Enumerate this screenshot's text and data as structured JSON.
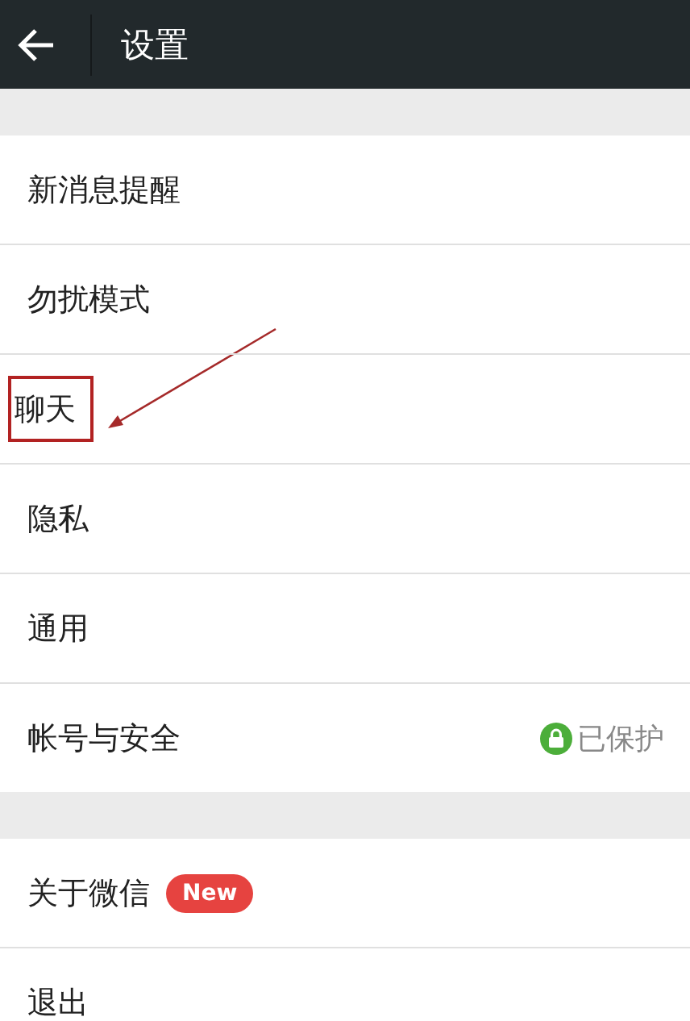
{
  "header": {
    "title": "设置"
  },
  "sections": [
    {
      "items": [
        {
          "label": "新消息提醒",
          "highlighted": false
        },
        {
          "label": "勿扰模式",
          "highlighted": false
        },
        {
          "label": "聊天",
          "highlighted": true
        },
        {
          "label": "隐私",
          "highlighted": false
        },
        {
          "label": "通用",
          "highlighted": false
        },
        {
          "label": "帐号与安全",
          "highlighted": false,
          "status": "已保护"
        }
      ]
    },
    {
      "items": [
        {
          "label": "关于微信",
          "highlighted": false,
          "badge": "New"
        },
        {
          "label": "退出",
          "highlighted": false
        }
      ]
    }
  ]
}
